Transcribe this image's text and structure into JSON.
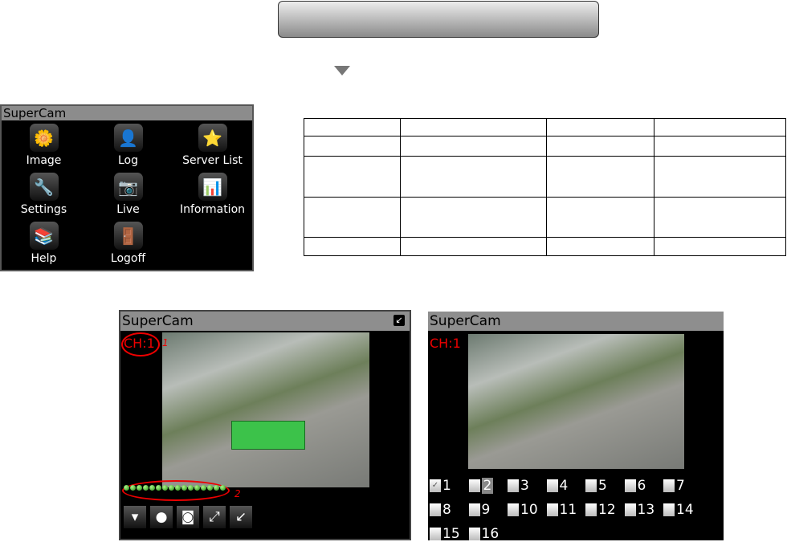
{
  "app_title": "SuperCam",
  "menu": {
    "items": [
      {
        "label": "Image",
        "icon": "image-icon"
      },
      {
        "label": "Log",
        "icon": "log-icon"
      },
      {
        "label": "Server List",
        "icon": "server-list-icon"
      },
      {
        "label": "Settings",
        "icon": "settings-icon"
      },
      {
        "label": "Live",
        "icon": "live-camera-icon"
      },
      {
        "label": "Information",
        "icon": "information-icon"
      },
      {
        "label": "Help",
        "icon": "help-icon"
      },
      {
        "label": "Logoff",
        "icon": "logoff-icon"
      }
    ]
  },
  "live": {
    "channel": "CH:1",
    "annotation_1": "1",
    "annotation_2": "2",
    "channel_dots": 16
  },
  "select": {
    "channel": "CH:1",
    "channels": [
      "1",
      "2",
      "3",
      "4",
      "5",
      "6",
      "7",
      "8",
      "9",
      "10",
      "11",
      "12",
      "13",
      "14",
      "15",
      "16"
    ],
    "checked": "1",
    "highlighted": "2"
  }
}
